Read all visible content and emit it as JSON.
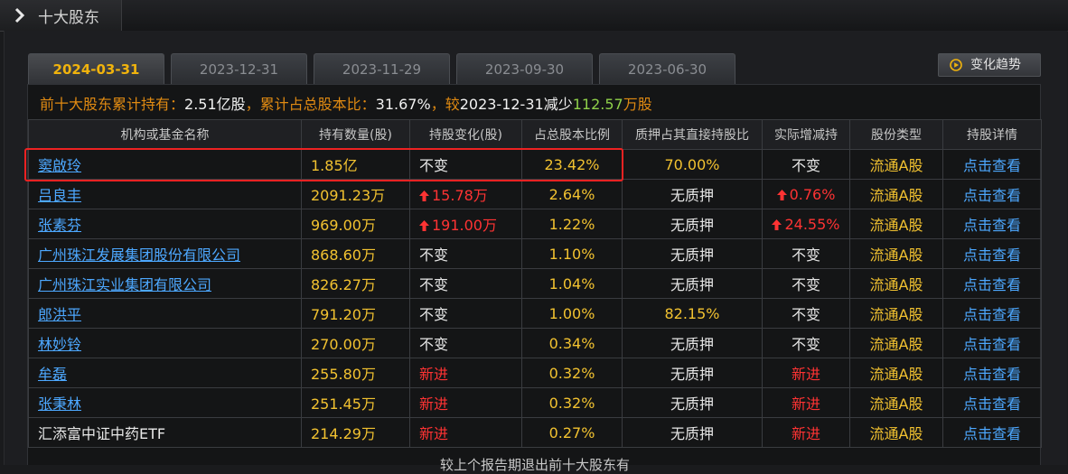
{
  "section_title": "十大股东",
  "tabs": [
    "2024-03-31",
    "2023-12-31",
    "2023-11-29",
    "2023-09-30",
    "2023-06-30"
  ],
  "trend_button": "变化趋势",
  "summary": {
    "p1": "前十大股东累计持有：",
    "v1": "2.51亿股",
    "p2": "，累计占总股本比：",
    "v2": "31.67%",
    "p3": "，较",
    "p4": "2023-12-31减少",
    "v3": "112.57",
    "p5": "万股"
  },
  "columns": [
    "机构或基金名称",
    "持有数量(股)",
    "持股变化(股)",
    "占总股本比例",
    "质押占其直接持股比",
    "实际增减持",
    "股份类型",
    "持股详情"
  ],
  "rows": [
    {
      "name": "窦啟玲",
      "link": true,
      "amount": "1.85亿",
      "change": "不变",
      "change_color": "w",
      "up": false,
      "ratio": "23.42%",
      "pledge": "70.00%",
      "pledge_color": "y",
      "actual": "不变",
      "actual_color": "w",
      "actual_up": false,
      "type": "流通A股",
      "detail": "点击查看"
    },
    {
      "name": "吕良丰",
      "link": true,
      "amount": "2091.23万",
      "change": "15.78万",
      "change_color": "r",
      "up": true,
      "ratio": "2.64%",
      "pledge": "无质押",
      "pledge_color": "w",
      "actual": "0.76%",
      "actual_color": "r",
      "actual_up": true,
      "type": "流通A股",
      "detail": "点击查看"
    },
    {
      "name": "张素芬",
      "link": true,
      "amount": "969.00万",
      "change": "191.00万",
      "change_color": "r",
      "up": true,
      "ratio": "1.22%",
      "pledge": "无质押",
      "pledge_color": "w",
      "actual": "24.55%",
      "actual_color": "r",
      "actual_up": true,
      "type": "流通A股",
      "detail": "点击查看"
    },
    {
      "name": "广州珠江发展集团股份有限公司",
      "link": true,
      "amount": "868.60万",
      "change": "不变",
      "change_color": "w",
      "up": false,
      "ratio": "1.10%",
      "pledge": "无质押",
      "pledge_color": "w",
      "actual": "不变",
      "actual_color": "w",
      "actual_up": false,
      "type": "流通A股",
      "detail": "点击查看"
    },
    {
      "name": "广州珠江实业集团有限公司",
      "link": true,
      "amount": "826.27万",
      "change": "不变",
      "change_color": "w",
      "up": false,
      "ratio": "1.04%",
      "pledge": "无质押",
      "pledge_color": "w",
      "actual": "不变",
      "actual_color": "w",
      "actual_up": false,
      "type": "流通A股",
      "detail": "点击查看"
    },
    {
      "name": "郎洪平",
      "link": true,
      "amount": "791.20万",
      "change": "不变",
      "change_color": "w",
      "up": false,
      "ratio": "1.00%",
      "pledge": "82.15%",
      "pledge_color": "y",
      "actual": "不变",
      "actual_color": "w",
      "actual_up": false,
      "type": "流通A股",
      "detail": "点击查看"
    },
    {
      "name": "林妙铃",
      "link": true,
      "amount": "270.00万",
      "change": "不变",
      "change_color": "w",
      "up": false,
      "ratio": "0.34%",
      "pledge": "无质押",
      "pledge_color": "w",
      "actual": "不变",
      "actual_color": "w",
      "actual_up": false,
      "type": "流通A股",
      "detail": "点击查看"
    },
    {
      "name": "牟磊",
      "link": true,
      "amount": "255.80万",
      "change": "新进",
      "change_color": "r",
      "up": false,
      "ratio": "0.32%",
      "pledge": "无质押",
      "pledge_color": "w",
      "actual": "新进",
      "actual_color": "r",
      "actual_up": false,
      "type": "流通A股",
      "detail": "点击查看"
    },
    {
      "name": "张秉林",
      "link": true,
      "amount": "251.45万",
      "change": "新进",
      "change_color": "r",
      "up": false,
      "ratio": "0.32%",
      "pledge": "无质押",
      "pledge_color": "w",
      "actual": "新进",
      "actual_color": "r",
      "actual_up": false,
      "type": "流通A股",
      "detail": "点击查看"
    },
    {
      "name": "汇添富中证中药ETF",
      "link": false,
      "amount": "214.29万",
      "change": "新进",
      "change_color": "r",
      "up": false,
      "ratio": "0.27%",
      "pledge": "无质押",
      "pledge_color": "w",
      "actual": "新进",
      "actual_color": "r",
      "actual_up": false,
      "type": "流通A股",
      "detail": "点击查看"
    }
  ],
  "footer_note": "较上个报告期退出前十大股东有",
  "colors": {
    "accent": "#f0b30d",
    "link": "#4da8ff",
    "up": "#ff3333",
    "down": "#8fd04a",
    "value": "#f2c230"
  }
}
